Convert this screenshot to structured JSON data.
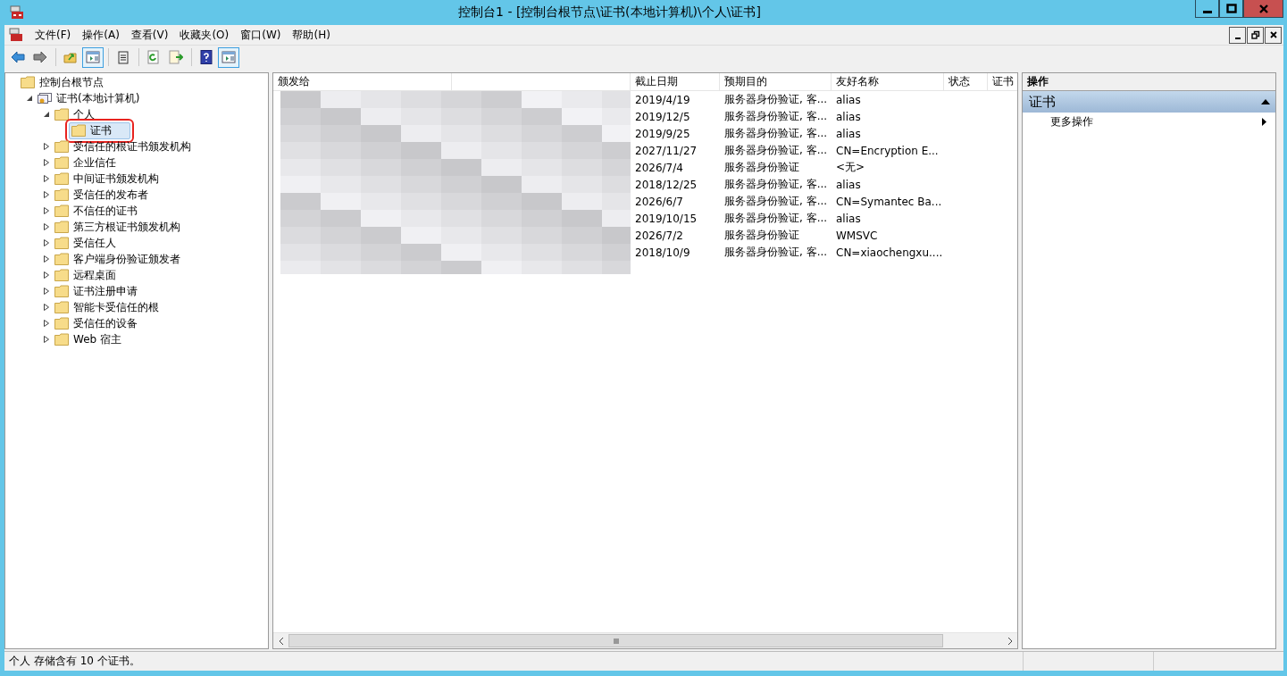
{
  "window": {
    "title": "控制台1 - [控制台根节点\\证书(本地计算机)\\个人\\证书]"
  },
  "menu": [
    "文件(F)",
    "操作(A)",
    "查看(V)",
    "收藏夹(O)",
    "窗口(W)",
    "帮助(H)"
  ],
  "toolbar": [
    {
      "kind": "back",
      "pressed": false
    },
    {
      "kind": "forward",
      "pressed": false
    },
    {
      "kind": "sep"
    },
    {
      "kind": "up",
      "pressed": false
    },
    {
      "kind": "tree",
      "pressed": true
    },
    {
      "kind": "sep"
    },
    {
      "kind": "clipboard",
      "pressed": false
    },
    {
      "kind": "sep"
    },
    {
      "kind": "refresh",
      "pressed": false
    },
    {
      "kind": "export",
      "pressed": false
    },
    {
      "kind": "sep"
    },
    {
      "kind": "help",
      "pressed": false
    },
    {
      "kind": "actions",
      "pressed": true
    }
  ],
  "tree": [
    {
      "label": "控制台根节点",
      "kind": "folder",
      "selected": false,
      "circled": false,
      "children": [
        {
          "label": "证书(本地计算机)",
          "kind": "store",
          "expanded": true,
          "selected": false,
          "circled": false,
          "children": [
            {
              "label": "个人",
              "kind": "folder",
              "expanded": true,
              "selected": false,
              "circled": false,
              "children": [
                {
                  "label": "证书",
                  "kind": "folder",
                  "selected": true,
                  "circled": true
                }
              ]
            },
            {
              "label": "受信任的根证书颁发机构",
              "kind": "folder",
              "expanded": false,
              "selected": false,
              "circled": false
            },
            {
              "label": "企业信任",
              "kind": "folder",
              "expanded": false,
              "selected": false,
              "circled": false
            },
            {
              "label": "中间证书颁发机构",
              "kind": "folder",
              "expanded": false,
              "selected": false,
              "circled": false
            },
            {
              "label": "受信任的发布者",
              "kind": "folder",
              "expanded": false,
              "selected": false,
              "circled": false
            },
            {
              "label": "不信任的证书",
              "kind": "folder",
              "expanded": false,
              "selected": false,
              "circled": false
            },
            {
              "label": "第三方根证书颁发机构",
              "kind": "folder",
              "expanded": false,
              "selected": false,
              "circled": false
            },
            {
              "label": "受信任人",
              "kind": "folder",
              "expanded": false,
              "selected": false,
              "circled": false
            },
            {
              "label": "客户端身份验证颁发者",
              "kind": "folder",
              "expanded": false,
              "selected": false,
              "circled": false
            },
            {
              "label": "远程桌面",
              "kind": "folder",
              "expanded": false,
              "selected": false,
              "circled": false
            },
            {
              "label": "证书注册申请",
              "kind": "folder",
              "expanded": false,
              "selected": false,
              "circled": false
            },
            {
              "label": "智能卡受信任的根",
              "kind": "folder",
              "expanded": false,
              "selected": false,
              "circled": false
            },
            {
              "label": "受信任的设备",
              "kind": "folder",
              "expanded": false,
              "selected": false,
              "circled": false
            },
            {
              "label": "Web 宿主",
              "kind": "folder",
              "expanded": false,
              "selected": false,
              "circled": false
            }
          ]
        }
      ]
    }
  ],
  "table": {
    "columns": [
      "颁发给",
      "",
      "截止日期",
      "预期目的",
      "友好名称",
      "状态",
      "证书"
    ],
    "rows": [
      {
        "expires": "2019/4/19",
        "purpose": "服务器身份验证, 客...",
        "friendly_name": "alias"
      },
      {
        "expires": "2019/12/5",
        "purpose": "服务器身份验证, 客...",
        "friendly_name": "alias"
      },
      {
        "expires": "2019/9/25",
        "purpose": "服务器身份验证, 客...",
        "friendly_name": "alias"
      },
      {
        "expires": "2027/11/27",
        "purpose": "服务器身份验证, 客...",
        "friendly_name": "CN=Encryption E..."
      },
      {
        "expires": "2026/7/4",
        "purpose": "服务器身份验证",
        "friendly_name": "<无>"
      },
      {
        "expires": "2018/12/25",
        "purpose": "服务器身份验证, 客...",
        "friendly_name": "alias"
      },
      {
        "expires": "2026/6/7",
        "purpose": "服务器身份验证, 客...",
        "friendly_name": "CN=Symantec Ba..."
      },
      {
        "expires": "2019/10/15",
        "purpose": "服务器身份验证, 客...",
        "friendly_name": "alias"
      },
      {
        "expires": "2026/7/2",
        "purpose": "服务器身份验证",
        "friendly_name": "WMSVC"
      },
      {
        "expires": "2018/10/9",
        "purpose": "服务器身份验证, 客...",
        "friendly_name": "CN=xiaochengxu...."
      }
    ]
  },
  "actions": {
    "title": "操作",
    "groups": [
      {
        "label": "证书",
        "expanded": true,
        "items": [
          "更多操作"
        ]
      }
    ]
  },
  "status_bar": "个人 存储含有 10 个证书。"
}
